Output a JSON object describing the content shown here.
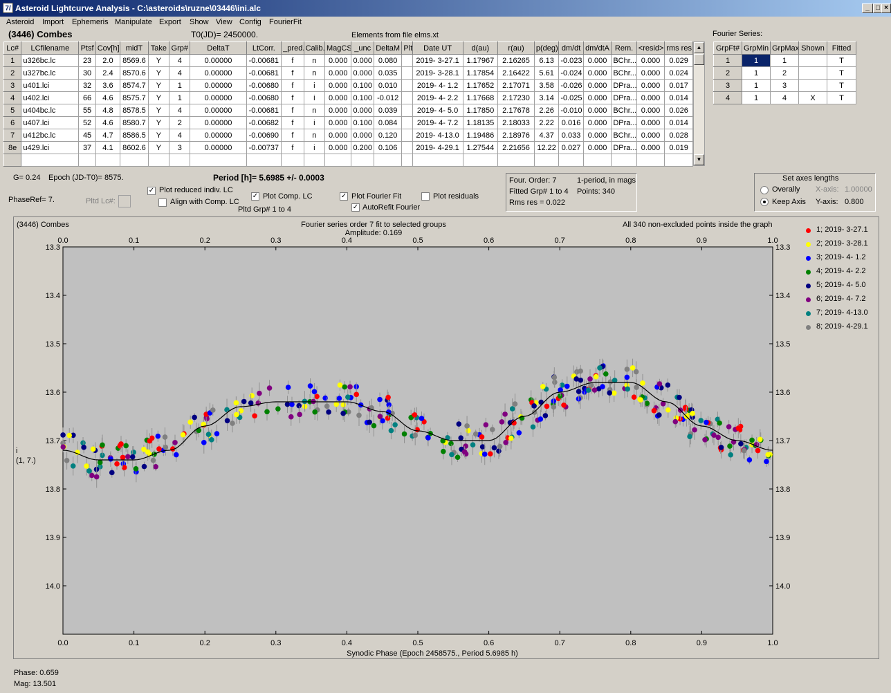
{
  "window": {
    "title": "Asteroid Lightcurve Analysis - C:\\asteroids\\ruzne\\03446\\ini.alc",
    "icon_label": "7/"
  },
  "menu": [
    "Asteroid",
    "Import",
    "Ephemeris",
    "Manipulate",
    "Export",
    "Show",
    "View",
    "Config",
    "FourierFit"
  ],
  "header": {
    "asteroid_name": "(3446) Combes",
    "t0": "T0(JD)= 2450000.",
    "elements": "Elements from file elms.xt"
  },
  "lc_table": {
    "columns": [
      "Lc#",
      "LCfilename",
      "Ptsf",
      "Cov[h]",
      "midT",
      "Take",
      "Grp#",
      "DeltaT",
      "LtCorr.",
      "_pred.",
      "Calib.",
      "MagCS",
      "_unc",
      "DeltaM",
      "Plt",
      "Date UT",
      "d(au)",
      "r(au)",
      "p(deg)",
      "dm/dt",
      "dm/dtA",
      "Rem.",
      "<resid>",
      "rms res"
    ],
    "rows": [
      [
        "1",
        "u326bc.lc",
        "23",
        "2.0",
        "8569.6",
        "Y",
        "4",
        "0.00000",
        "-0.00681",
        "f",
        "n",
        "0.000",
        "0.000",
        "0.080",
        "",
        "2019- 3-27.1",
        "1.17967",
        "2.16265",
        "6.13",
        "-0.023",
        "0.000",
        "BChr...",
        "0.000",
        "0.029"
      ],
      [
        "2",
        "u327bc.lc",
        "30",
        "2.4",
        "8570.6",
        "Y",
        "4",
        "0.00000",
        "-0.00681",
        "f",
        "n",
        "0.000",
        "0.000",
        "0.035",
        "",
        "2019- 3-28.1",
        "1.17854",
        "2.16422",
        "5.61",
        "-0.024",
        "0.000",
        "BChr...",
        "0.000",
        "0.024"
      ],
      [
        "3",
        "u401.lci",
        "32",
        "3.6",
        "8574.7",
        "Y",
        "1",
        "0.00000",
        "-0.00680",
        "f",
        "i",
        "0.000",
        "0.100",
        "0.010",
        "",
        "2019- 4- 1.2",
        "1.17652",
        "2.17071",
        "3.58",
        "-0.026",
        "0.000",
        "DPra...",
        "0.000",
        "0.017"
      ],
      [
        "4",
        "u402.lci",
        "66",
        "4.6",
        "8575.7",
        "Y",
        "1",
        "0.00000",
        "-0.00680",
        "f",
        "i",
        "0.000",
        "0.100",
        "-0.012",
        "",
        "2019- 4- 2.2",
        "1.17668",
        "2.17230",
        "3.14",
        "-0.025",
        "0.000",
        "DPra...",
        "0.000",
        "0.014"
      ],
      [
        "5",
        "u404bc.lc",
        "55",
        "4.8",
        "8578.5",
        "Y",
        "4",
        "0.00000",
        "-0.00681",
        "f",
        "n",
        "0.000",
        "0.000",
        "0.039",
        "",
        "2019- 4- 5.0",
        "1.17850",
        "2.17678",
        "2.26",
        "-0.010",
        "0.000",
        "BChr...",
        "0.000",
        "0.026"
      ],
      [
        "6",
        "u407.lci",
        "52",
        "4.6",
        "8580.7",
        "Y",
        "2",
        "0.00000",
        "-0.00682",
        "f",
        "i",
        "0.000",
        "0.100",
        "0.084",
        "",
        "2019- 4- 7.2",
        "1.18135",
        "2.18033",
        "2.22",
        "0.016",
        "0.000",
        "DPra...",
        "0.000",
        "0.014"
      ],
      [
        "7",
        "u412bc.lc",
        "45",
        "4.7",
        "8586.5",
        "Y",
        "4",
        "0.00000",
        "-0.00690",
        "f",
        "n",
        "0.000",
        "0.000",
        "0.120",
        "",
        "2019- 4-13.0",
        "1.19486",
        "2.18976",
        "4.37",
        "0.033",
        "0.000",
        "BChr...",
        "0.000",
        "0.028"
      ],
      [
        "8e",
        "u429.lci",
        "37",
        "4.1",
        "8602.6",
        "Y",
        "3",
        "0.00000",
        "-0.00737",
        "f",
        "i",
        "0.000",
        "0.200",
        "0.106",
        "",
        "2019- 4-29.1",
        "1.27544",
        "2.21656",
        "12.22",
        "0.027",
        "0.000",
        "DPra...",
        "0.000",
        "0.019"
      ]
    ]
  },
  "fourier_table": {
    "title": "Fourier Series:",
    "columns": [
      "GrpFt#",
      "GrpMin",
      "GrpMax",
      "Shown",
      "Fitted"
    ],
    "rows": [
      [
        "1",
        "1",
        "1",
        "",
        "T"
      ],
      [
        "2",
        "1",
        "2",
        "",
        "T"
      ],
      [
        "3",
        "1",
        "3",
        "",
        "T"
      ],
      [
        "4",
        "1",
        "4",
        "X",
        "T"
      ]
    ]
  },
  "controls": {
    "g": "G= 0.24",
    "epoch": "Epoch (JD-T0)= 8575.",
    "period": "Period [h]= 5.6985 +/- 0.0003",
    "phaseref": "PhaseRef= 7.",
    "pltd_lc": "Pltd Lc#:",
    "plot_reduced": "Plot reduced indiv. LC",
    "align_comp": "Align with Comp. LC",
    "plot_comp": "Plot Comp. LC",
    "pltd_grp": "Pltd Grp#  1   to   4",
    "plot_fourier": "Plot Fourier Fit",
    "autorefit": "AutoRefit Fourier",
    "plot_resid": "Plot residuals"
  },
  "fourier_info": {
    "order": "Four. Order:  7",
    "mode": "1-period, in mags",
    "fitted": "Fitted Grp# 1 to 4",
    "points": "Points: 340",
    "rms": "Rms res      = 0.022"
  },
  "axes_box": {
    "title": "Set axes lengths",
    "overally": "Overally",
    "keep": "Keep Axis",
    "xaxis_lbl": "X-axis:",
    "xaxis_val": "1.00000",
    "yaxis_lbl": "Y-axis:",
    "yaxis_val": "0.800"
  },
  "chart_data": {
    "type": "scatter",
    "title": "Fourier series order 7 fit to selected groups",
    "subtitle": "Amplitude: 0.169",
    "left_label": "(3446) Combes",
    "right_label": "All 340 non-excluded points inside the graph",
    "xlabel": "Synodic Phase (Epoch 2458575., Period 5.6985 h)",
    "ylabel": [
      "i",
      "(1, 7.)"
    ],
    "xlim": [
      0,
      1
    ],
    "ylim": [
      13.3,
      14.1
    ],
    "y_inverted": true,
    "xticks": [
      "0.0",
      "0.1",
      "0.2",
      "0.3",
      "0.4",
      "0.5",
      "0.6",
      "0.7",
      "0.8",
      "0.9",
      "1.0"
    ],
    "yticks": [
      "13.3",
      "13.4",
      "13.5",
      "13.6",
      "13.7",
      "13.8",
      "13.9",
      "14.0"
    ],
    "series": [
      {
        "name": "1; 2019- 3-27.1",
        "color": "#ff0000"
      },
      {
        "name": "2; 2019- 3-28.1",
        "color": "#ffff00"
      },
      {
        "name": "3; 2019- 4- 1.2",
        "color": "#0000ff"
      },
      {
        "name": "4; 2019- 4- 2.2",
        "color": "#008000"
      },
      {
        "name": "5; 2019- 4- 5.0",
        "color": "#000080"
      },
      {
        "name": "6; 2019- 4- 7.2",
        "color": "#800080"
      },
      {
        "name": "7; 2019- 4-13.0",
        "color": "#008080"
      },
      {
        "name": "8; 2019- 4-29.1",
        "color": "#808080"
      }
    ],
    "fit_curve": {
      "x": [
        0,
        0.05,
        0.1,
        0.15,
        0.2,
        0.25,
        0.3,
        0.35,
        0.4,
        0.45,
        0.5,
        0.55,
        0.6,
        0.65,
        0.7,
        0.75,
        0.8,
        0.85,
        0.9,
        0.95,
        1.0
      ],
      "y": [
        13.72,
        13.74,
        13.74,
        13.72,
        13.67,
        13.63,
        13.62,
        13.62,
        13.62,
        13.64,
        13.68,
        13.7,
        13.7,
        13.65,
        13.6,
        13.58,
        13.58,
        13.62,
        13.67,
        13.7,
        13.72
      ]
    }
  },
  "status": {
    "phase": "Phase:  0.659",
    "mag": "Mag:   13.501"
  }
}
